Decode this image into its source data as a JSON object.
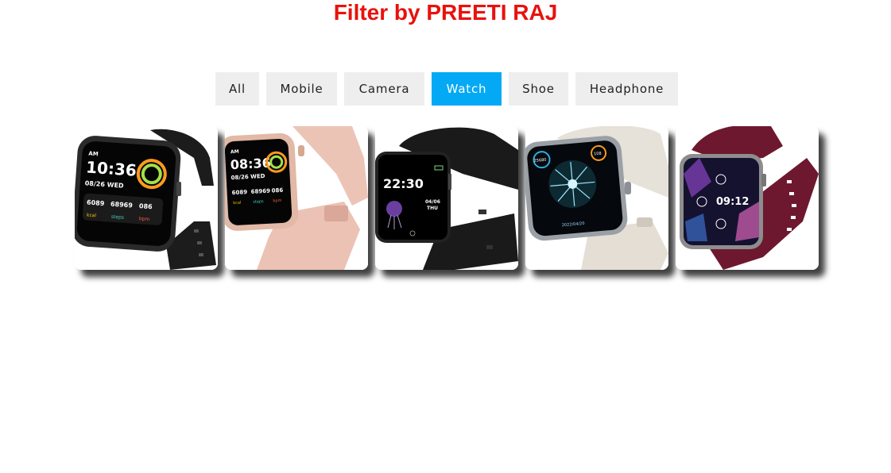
{
  "page": {
    "title": "Filter by PREETI RAJ"
  },
  "filters": [
    {
      "label": "All",
      "active": false
    },
    {
      "label": "Mobile",
      "active": false
    },
    {
      "label": "Camera",
      "active": false
    },
    {
      "label": "Watch",
      "active": true
    },
    {
      "label": "Shoe",
      "active": false
    },
    {
      "label": "Headphone",
      "active": false
    }
  ],
  "colors": {
    "title": "#e8120c",
    "active": "#03a9f4",
    "inactive": "#eeeeee"
  },
  "products": [
    {
      "name": "black-smartwatch",
      "strap_color": "#1c1c1c",
      "screen": {
        "am": "AM",
        "time": "10:36",
        "date": "08/26 WED",
        "stats": [
          "6089",
          "68969",
          "086"
        ],
        "stat_labels": [
          "kcal",
          "steps",
          "bpm"
        ]
      }
    },
    {
      "name": "pink-smartwatch",
      "strap_color": "#ecc4b6",
      "screen": {
        "am": "AM",
        "time": "08:36",
        "date": "08/26 WED",
        "stats": [
          "6089",
          "68969",
          "086"
        ],
        "stat_labels": [
          "kcal",
          "steps",
          "bpm"
        ]
      }
    },
    {
      "name": "black-square-smartwatch",
      "strap_color": "#1a1a1a",
      "screen": {
        "time": "22:30",
        "date": "04/06",
        "day": "THU"
      }
    },
    {
      "name": "white-smartwatch",
      "strap_color": "#e6e1d9",
      "screen": {
        "top_left": "25680",
        "top_right": "108",
        "bottom": "2022/04/20"
      }
    },
    {
      "name": "maroon-smartwatch",
      "strap_color": "#6e1830",
      "screen": {
        "time": "09:12"
      }
    }
  ]
}
